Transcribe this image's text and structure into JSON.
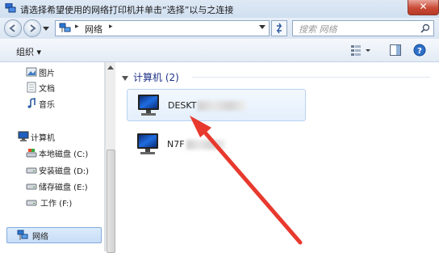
{
  "window": {
    "title": "请选择希望使用的网络打印机并单击“选择”以与之连接",
    "close_symbol": "✕"
  },
  "address_bar": {
    "segments": [
      "网络"
    ],
    "separator": "▸",
    "search_placeholder": "搜索 网络"
  },
  "toolbar": {
    "organize_label": "组织 ▾"
  },
  "sidebar": {
    "items": [
      {
        "label": "图片",
        "icon": "pictures-icon"
      },
      {
        "label": "文档",
        "icon": "documents-icon"
      },
      {
        "label": "音乐",
        "icon": "music-icon"
      },
      {
        "label": "计算机",
        "icon": "computer-icon"
      },
      {
        "label": "本地磁盘 (C:)",
        "icon": "system-drive-icon"
      },
      {
        "label": "安装磁盘 (D:)",
        "icon": "drive-icon"
      },
      {
        "label": "储存磁盘 (E:)",
        "icon": "drive-icon"
      },
      {
        "label": "工作 (F:)",
        "icon": "drive-icon"
      },
      {
        "label": "网络",
        "icon": "network-icon",
        "selected": true
      }
    ]
  },
  "content": {
    "group_title": "计算机 (2)",
    "computers": [
      {
        "name": "DESKT",
        "selected": true
      },
      {
        "name": "N7F",
        "selected": false
      }
    ]
  },
  "colors": {
    "annotation_arrow": "#e8392e",
    "selection": "#c7ddf7",
    "group_title": "#1e3287"
  }
}
